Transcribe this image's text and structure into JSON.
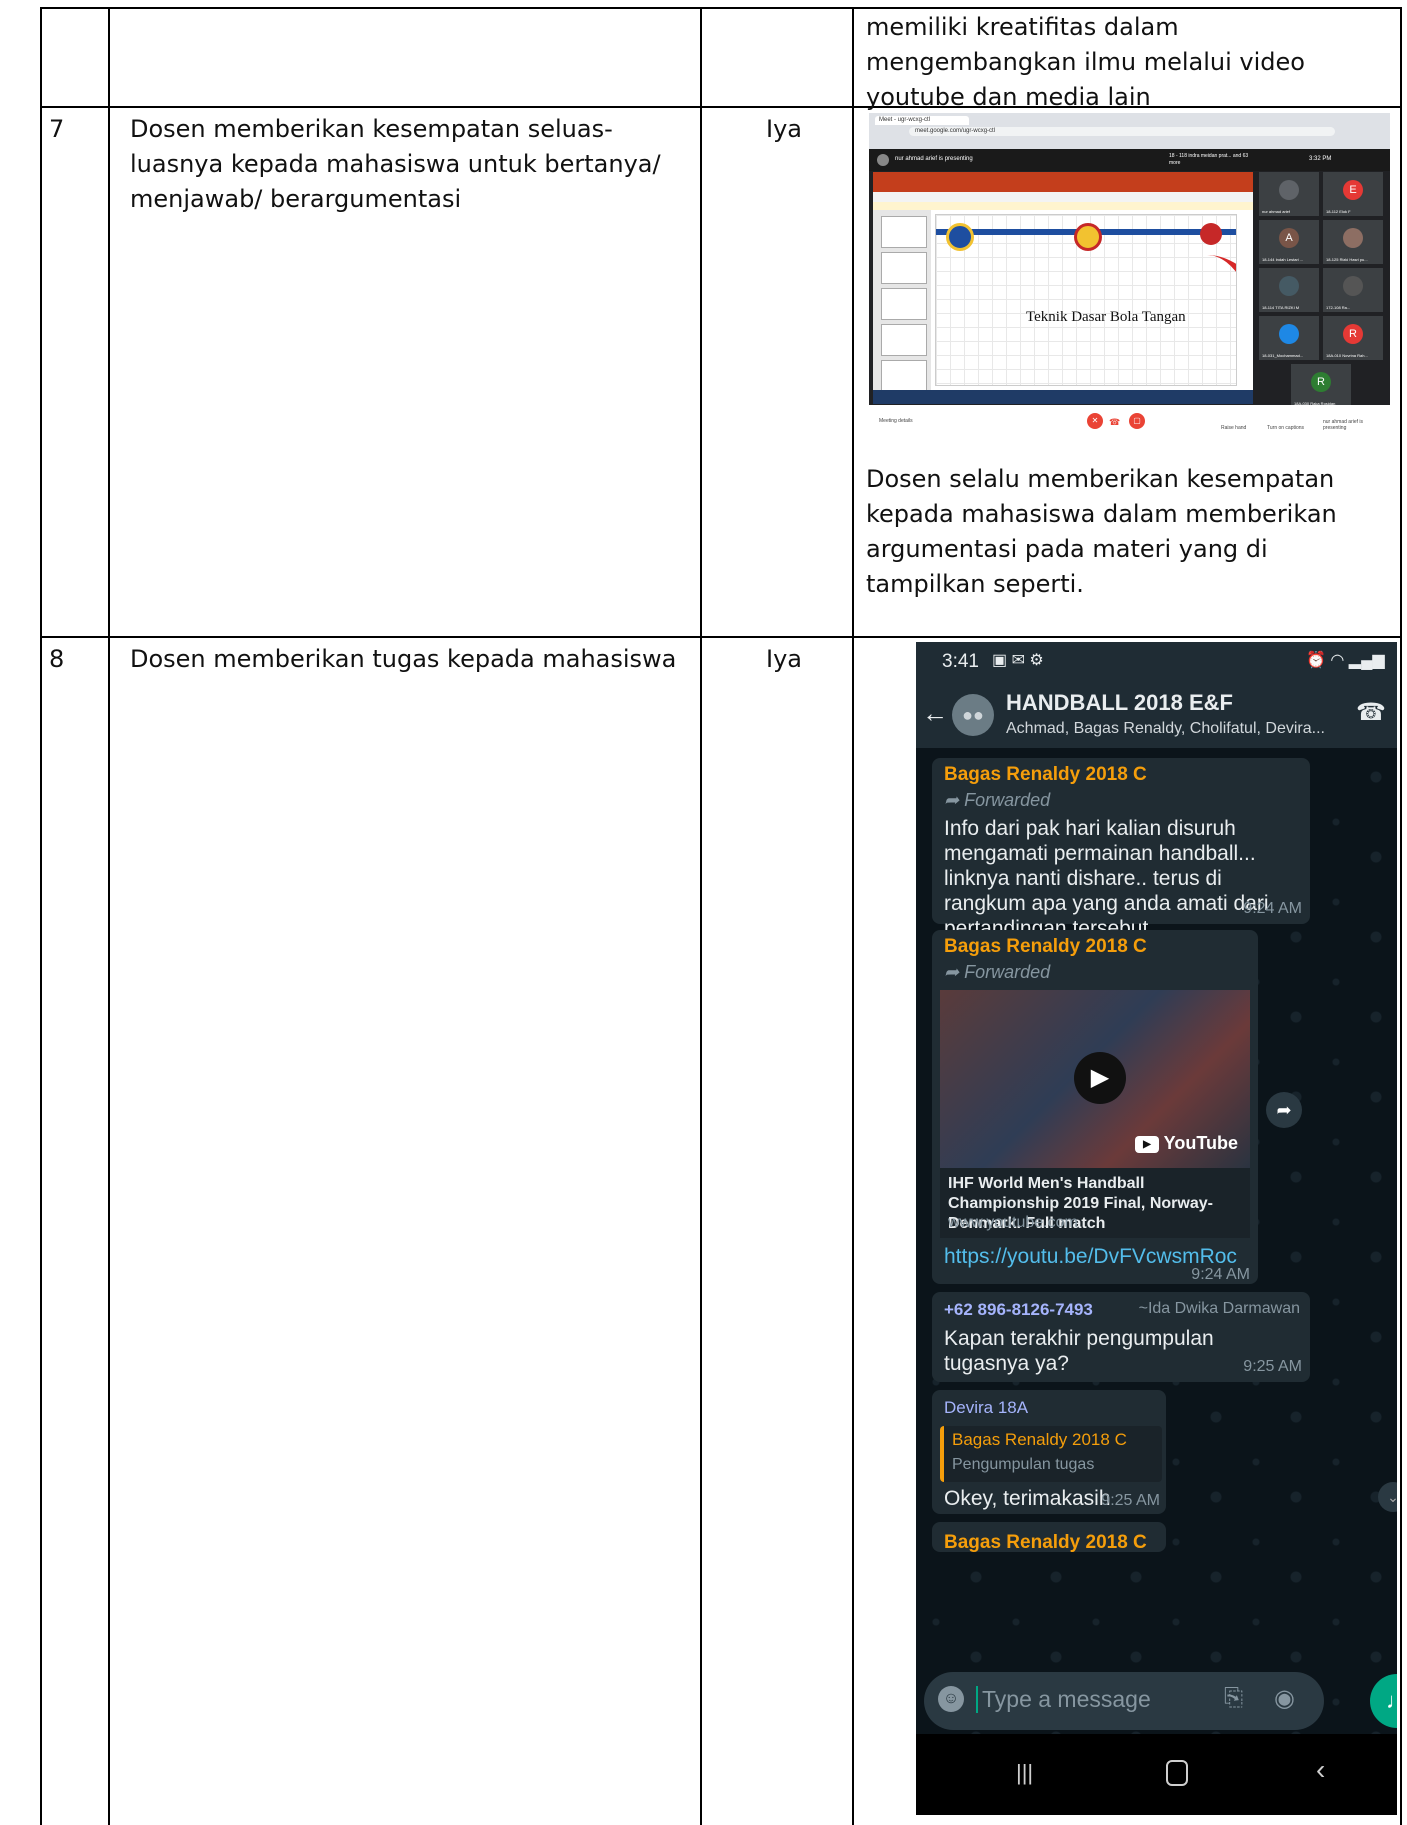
{
  "rows": [
    {
      "no": "",
      "criteria": "",
      "answer": "",
      "evidence_text": "memiliki kreatifitas dalam mengembangkan ilmu melalui video youtube dan media lain"
    },
    {
      "no": "7",
      "criteria": "Dosen memberikan kesempatan seluas-luasnya kepada mahasiswa untuk bertanya/ menjawab/ berargumentasi",
      "answer": "Iya",
      "evidence_text": "Dosen selalu memberikan kesempatan kepada mahasiswa dalam memberikan argumentasi pada materi yang di tampilkan seperti."
    },
    {
      "no": "8",
      "criteria": "Dosen memberikan tugas kepada mahasiswa",
      "answer": "Iya",
      "evidence_text": ""
    }
  ],
  "meet": {
    "tab": "Meet - ugr-wcxg-ctl",
    "url": "meet.google.com/ugr-wcxg-ctl",
    "presenting": "nur ahmad arief is presenting",
    "more": "18 - 118 indra meidan prat... and 63 more",
    "time": "3:32 PM",
    "slide_title": "Teknik Dasar Bola Tangan",
    "participants": [
      {
        "initial": "",
        "label": "nur ahmad arief",
        "color": "#5f6368"
      },
      {
        "initial": "E",
        "label": "18-112 Elok F",
        "color": "#e53935"
      },
      {
        "initial": "A",
        "label": "18-144 Indah Lestari ...",
        "color": "#795548"
      },
      {
        "initial": "",
        "label": "18-125 Rizki Hasri pu...",
        "color": "#8d6e63"
      },
      {
        "initial": "",
        "label": "18-114 TITA RIZKI M",
        "color": "#455a64"
      },
      {
        "initial": "",
        "label": "172-108 Ra...",
        "color": "#555"
      },
      {
        "initial": "",
        "label": "18-031_Mochammad...",
        "color": "#1e88e5"
      },
      {
        "initial": "R",
        "label": "18A-010 Novrina Rah...",
        "color": "#e53935"
      },
      {
        "initial": "R",
        "label": "18A-030 Raka Rosidan",
        "color": "#2e7d32"
      }
    ],
    "meeting_details": "Meeting details",
    "raise_hand": "Raise hand",
    "captions": "Turn on captions",
    "presenter_note": "nur ahmad arief is presenting"
  },
  "whatsapp": {
    "status_time": "3:41",
    "group_name": "HANDBALL 2018 E&F",
    "members": "Achmad, Bagas Renaldy, Cholifatul, Devira...",
    "forwarded": "Forwarded",
    "msg1": {
      "sender": "Bagas Renaldy 2018 C",
      "text": "Info dari pak hari kalian disuruh mengamati permainan handball... linknya nanti dishare.. terus di rangkum apa yang anda amati dari pertandingan tersebut...",
      "time": "9:24 AM"
    },
    "msg2": {
      "sender": "Bagas Renaldy 2018 C",
      "yt_title": "IHF World Men's Handball Championship 2019 Final, Norway-Denmark. Full match",
      "yt_site": "www.youtube.com",
      "link": "https://youtu.be/DvFVcwsmRoc",
      "time": "9:24 AM",
      "yt_brand": "YouTube"
    },
    "msg3": {
      "sender": "+62 896-8126-7493",
      "alias": "~Ida Dwika Darmawan",
      "text": "Kapan terakhir pengumpulan tugasnya ya?",
      "time": "9:25 AM"
    },
    "msg4": {
      "sender": "Devira 18A",
      "quote_sender": "Bagas Renaldy 2018 C",
      "quote_text": "Pengumpulan tugas",
      "text": "Okey, terimakasih",
      "time": "9:25 AM"
    },
    "msg5_sender": "Bagas Renaldy 2018 C",
    "placeholder": "Type a message",
    "colors": {
      "sender_orange": "#f59e0b",
      "sender_blue": "#53bdeb",
      "sender_purple": "#a5b4fc",
      "link": "#53bdeb",
      "mic": "#00a884"
    }
  }
}
